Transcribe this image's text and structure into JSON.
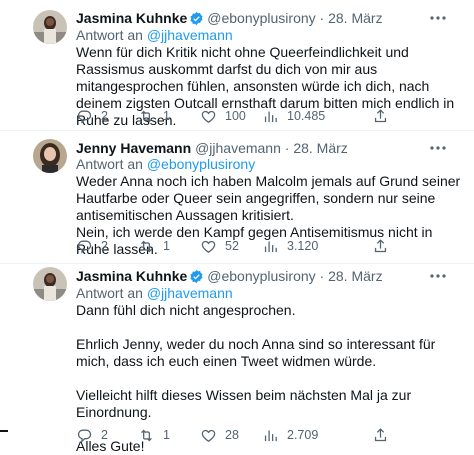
{
  "tweets": [
    {
      "name": "Jasmina Kuhnke",
      "handle": "@ebonyplusirony",
      "sep": "·",
      "date": "28. März",
      "reply_prefix": "Antwort an",
      "reply_to": "@jjhavemann",
      "text": "Wenn für dich Kritik nicht ohne Queerfeindlichkeit und Rassismus auskommt darfst du dich von mir aus mitangesprochen fühlen, ansonsten würde ich dich, nach deinem zigsten Outcall ernsthaft darum bitten mich endlich in Ruhe zu lassen.",
      "replies": "2",
      "retweets": "1",
      "likes": "100",
      "views": "10.485",
      "verified": true
    },
    {
      "name": "Jenny Havemann",
      "handle": "@jjhavemann",
      "sep": "·",
      "date": "28. März",
      "reply_prefix": "Antwort an",
      "reply_to": "@ebonyplusirony",
      "text": "Weder Anna noch ich haben Malcolm jemals auf Grund seiner Hautfarbe oder Queer sein angegriffen, sondern nur seine antisemitischen Aussagen kritisiert.\nNein, ich werde den Kampf gegen Antisemitismus nicht in Ruhe lassen.",
      "replies": "2",
      "retweets": "1",
      "likes": "52",
      "views": "3.120",
      "verified": false
    },
    {
      "name": "Jasmina Kuhnke",
      "handle": "@ebonyplusirony",
      "sep": "·",
      "date": "28. März",
      "reply_prefix": "Antwort an",
      "reply_to": "@jjhavemann",
      "text": "Dann fühl dich nicht angesprochen.\n\nEhrlich Jenny, weder du noch Anna sind so interessant für mich, dass ich euch einen Tweet widmen würde.\n\nVielleicht hilft dieses Wissen beim nächsten Mal ja zur Einordnung.\n\nAlles Gute!",
      "replies": "2",
      "retweets": "1",
      "likes": "28",
      "views": "2.709",
      "verified": true
    }
  ],
  "colors": {
    "accent": "#1d9bf0",
    "muted": "#536471",
    "text": "#0f1419"
  }
}
